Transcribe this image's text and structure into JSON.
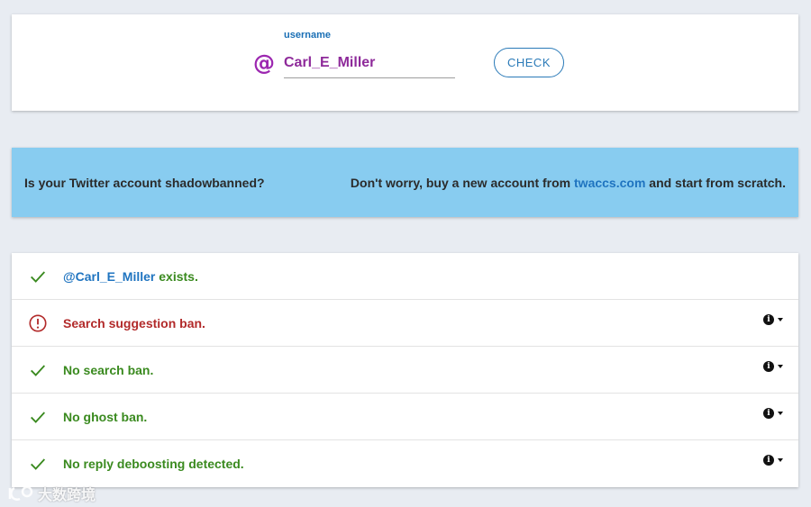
{
  "search": {
    "label": "username",
    "at_symbol": "@",
    "value": "Carl_E_Miller",
    "check_label": "CHECK"
  },
  "banner": {
    "left_text": "Is your Twitter account shadowbanned?",
    "right_prefix": "Don't worry, buy a new account from ",
    "link_text": "twaccs.com",
    "right_suffix": " and start from scratch."
  },
  "results": {
    "exists": {
      "mention": "@Carl_E_Miller",
      "suffix": " exists.",
      "status": "ok"
    },
    "items": [
      {
        "text": "Search suggestion ban.",
        "status": "error"
      },
      {
        "text": "No search ban.",
        "status": "ok"
      },
      {
        "text": "No ghost ban.",
        "status": "ok"
      },
      {
        "text": "No reply deboosting detected.",
        "status": "ok"
      }
    ]
  },
  "watermark": {
    "text": "大数跨境"
  },
  "colors": {
    "ok": "#3a8a1f",
    "error": "#b22a2a",
    "link": "#1f74c0",
    "banner": "#88ccf0",
    "at_icon": "#9c27b0"
  },
  "icons": {
    "ok": "check-icon",
    "error": "alert-circle-icon",
    "info": "info-icon",
    "expand": "caret-down-icon"
  }
}
